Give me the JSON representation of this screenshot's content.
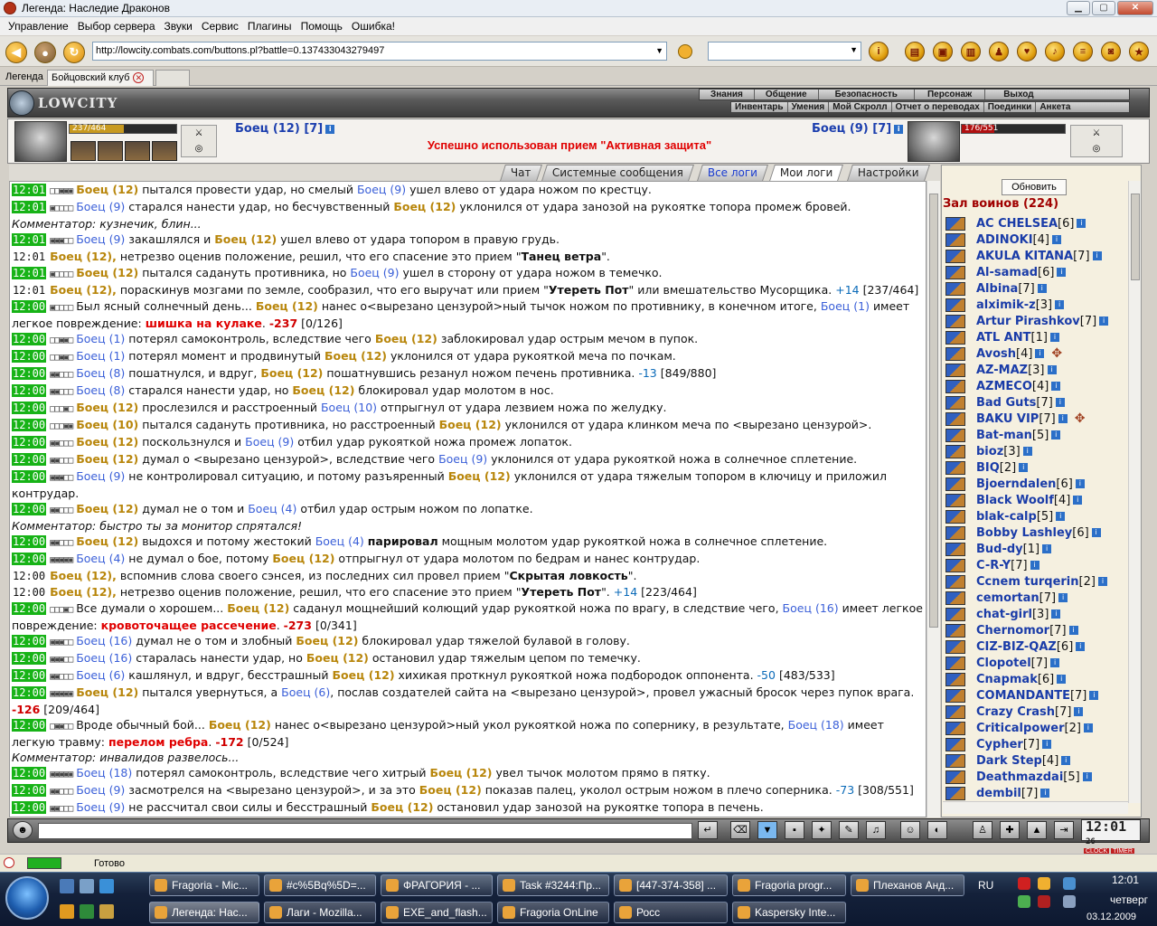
{
  "window": {
    "title": "Легенда: Наследие Драконов"
  },
  "menu": [
    "Управление",
    "Выбор сервера",
    "Звуки",
    "Сервис",
    "Плагины",
    "Помощь",
    "Ошибка!"
  ],
  "address": {
    "url": "http://lowcity.combats.com/buttons.pl?battle=0.137433043279497"
  },
  "tabs": {
    "legend": "Легенда",
    "club": "Бойцовский клуб"
  },
  "nav_top": [
    "Знания",
    "Общение",
    "Безопасность",
    "Персонаж",
    "Выход"
  ],
  "nav_bottom": [
    "Инвентарь",
    "Умения",
    "Мой Скролл",
    "Отчет о переводах",
    "Поединки",
    "Анкета"
  ],
  "logo_text": "LOWCITY",
  "player_left": {
    "name": "Боец (12) [7]",
    "hp": "237/464",
    "hp_fraction": 0.51
  },
  "player_right": {
    "name": "Боец (9) [7]",
    "hp": "176/551",
    "hp_fraction": 0.32
  },
  "status_message": "Успешно использован прием \"Активная защита\"",
  "log_tabs": [
    "Чат",
    "Системные сообщения",
    "Все логи",
    "Мои логи",
    "Настройки"
  ],
  "refresh_label": "Обновить",
  "room_title": "Зал воинов (224)",
  "users": [
    {
      "name": "AC CHELSEA",
      "level": "[6]"
    },
    {
      "name": "ADINOKI",
      "level": "[4]"
    },
    {
      "name": "AKULA KITANA",
      "level": "[7]"
    },
    {
      "name": "Al-samad",
      "level": "[6]"
    },
    {
      "name": "Albina",
      "level": "[7]"
    },
    {
      "name": "alximik-z",
      "level": "[3]"
    },
    {
      "name": "Artur Pirashkov",
      "level": "[7]"
    },
    {
      "name": "ATL ANT",
      "level": "[1]"
    },
    {
      "name": "Avosh",
      "level": "[4]"
    },
    {
      "name": "AZ-MAZ",
      "level": "[3]"
    },
    {
      "name": "AZMECO",
      "level": "[4]"
    },
    {
      "name": "Bad Guts",
      "level": "[7]"
    },
    {
      "name": "BAKU VIP",
      "level": "[7]"
    },
    {
      "name": "Bat-man",
      "level": "[5]"
    },
    {
      "name": "bioz",
      "level": "[3]"
    },
    {
      "name": "BIQ",
      "level": "[2]"
    },
    {
      "name": "Bjoerndalen",
      "level": "[6]"
    },
    {
      "name": "Black Woolf",
      "level": "[4]"
    },
    {
      "name": "blak-calp",
      "level": "[5]"
    },
    {
      "name": "Bobby Lashley",
      "level": "[6]"
    },
    {
      "name": "Bud-dy",
      "level": "[1]"
    },
    {
      "name": "C-R-Y",
      "level": "[7]"
    },
    {
      "name": "Ccnem turqerin",
      "level": "[2]"
    },
    {
      "name": "cemortan",
      "level": "[7]"
    },
    {
      "name": "chat-girl",
      "level": "[3]"
    },
    {
      "name": "Chernomor",
      "level": "[7]"
    },
    {
      "name": "CIZ-BIZ-QAZ",
      "level": "[6]"
    },
    {
      "name": "Clopotel",
      "level": "[7]"
    },
    {
      "name": "Cnapmak",
      "level": "[6]"
    },
    {
      "name": "COMANDANTE",
      "level": "[7]"
    },
    {
      "name": "Crazy Crash",
      "level": "[7]"
    },
    {
      "name": "Criticalpower",
      "level": "[2]"
    },
    {
      "name": "Cypher",
      "level": "[7]"
    },
    {
      "name": "Dark Step",
      "level": "[4]"
    },
    {
      "name": "Deathmazdai",
      "level": "[5]"
    },
    {
      "name": "dembil",
      "level": "[7]"
    }
  ],
  "clock": {
    "time": "12:01",
    "sec": "26",
    "labels": [
      "CLOCK",
      "TIMER"
    ]
  },
  "statusbar": {
    "text": "Готово"
  },
  "taskbar": {
    "top_row": [
      "Fragoria - Mic...",
      "#c%5Bq%5D=...",
      "ФРАГОРИЯ - ...",
      "Task #3244:Пр...",
      "[447-374-358] ...",
      "Fragoria progr...",
      "Плеханов Анд..."
    ],
    "bottom_row": [
      "Легенда: Нас...",
      "Лаги - Mozilla...",
      "EXE_and_flash...",
      "Fragoria OnLine",
      "Росс",
      "Kaspersky Inte..."
    ],
    "lang": "RU",
    "time": "12:01",
    "day": "четверг",
    "date": "03.12.2009"
  },
  "log": [
    {
      "t": "12:01",
      "hl": true,
      "b": "□□▣▣▣",
      "parts": [
        [
          "p",
          "Боец (12)"
        ],
        [
          "",
          "пытался провести удар, но смелый"
        ],
        [
          "e",
          "Боец (9)"
        ],
        [
          "",
          "ушел влево от удара ножом по крестцу."
        ]
      ]
    },
    {
      "t": "12:01",
      "hl": true,
      "b": "▣□□□□",
      "parts": [
        [
          "e",
          "Боец (9)"
        ],
        [
          "",
          "старался нанести удар, но бесчувственный"
        ],
        [
          "p",
          "Боец (12)"
        ],
        [
          "",
          "уклонился от удара занозой на рукоятке топора промеж бровей."
        ]
      ]
    },
    {
      "cm": "Комментатор: кузнечик, блин..."
    },
    {
      "t": "12:01",
      "hl": true,
      "b": "▣▣▣□□",
      "parts": [
        [
          "e",
          "Боец (9)"
        ],
        [
          "",
          "закашлялся и"
        ],
        [
          "p",
          "Боец (12)"
        ],
        [
          "",
          "ушел влево от удара топором в правую грудь."
        ]
      ]
    },
    {
      "t": "12:01",
      "hl": false,
      "parts": [
        [
          "p",
          "Боец (12),"
        ],
        [
          "",
          "нетрезво оценив положение, решил, что его спасение это прием \""
        ],
        [
          "bold",
          "Танец ветра"
        ],
        [
          "",
          "\"."
        ]
      ]
    },
    {
      "t": "12:01",
      "hl": true,
      "b": "▣□□□□",
      "parts": [
        [
          "p",
          "Боец (12)"
        ],
        [
          "",
          "пытался садануть противника, но"
        ],
        [
          "e",
          "Боец (9)"
        ],
        [
          "",
          "ушел в сторону от удара ножом в темечко."
        ]
      ]
    },
    {
      "t": "12:01",
      "hl": false,
      "parts": [
        [
          "p",
          "Боец (12),"
        ],
        [
          "",
          "пораскинув мозгами по земле, сообразил, что его выручат или прием \""
        ],
        [
          "bold",
          "Утереть Пот"
        ],
        [
          "",
          "\" или вмешательство Мусорщика."
        ],
        [
          "heal",
          "+14"
        ],
        [
          "",
          "[237/464]"
        ]
      ]
    },
    {
      "t": "12:00",
      "hl": true,
      "b": "▣□□□□",
      "parts": [
        [
          "",
          "Был ясный солнечный день..."
        ],
        [
          "p",
          "Боец (12)"
        ],
        [
          "",
          "нанес о<вырезано цензурой>ный тычок ножом по противнику, в конечном итоге,"
        ],
        [
          "e",
          "Боец (1)"
        ],
        [
          "",
          "имеет легкое повреждение:"
        ],
        [
          "red",
          "шишка на кулаке"
        ],
        [
          "",
          "."
        ],
        [
          "hpv",
          "-237"
        ],
        [
          "",
          "[0/126]"
        ]
      ]
    },
    {
      "t": "12:00",
      "hl": true,
      "b": "□□▣▣□",
      "parts": [
        [
          "e",
          "Боец (1)"
        ],
        [
          "",
          "потерял самоконтроль, вследствие чего"
        ],
        [
          "p",
          "Боец (12)"
        ],
        [
          "",
          "заблокировал удар острым мечом в пупок."
        ]
      ]
    },
    {
      "t": "12:00",
      "hl": true,
      "b": "□□▣▣□",
      "parts": [
        [
          "e",
          "Боец (1)"
        ],
        [
          "",
          "потерял момент и продвинутый"
        ],
        [
          "p",
          "Боец (12)"
        ],
        [
          "",
          "уклонился от удара рукояткой меча по почкам."
        ]
      ]
    },
    {
      "t": "12:00",
      "hl": true,
      "b": "▣▣□□□",
      "parts": [
        [
          "e",
          "Боец (8)"
        ],
        [
          "",
          "пошатнулся, и вдруг,"
        ],
        [
          "p",
          "Боец (12)"
        ],
        [
          "",
          "пошатнувшись резанул ножом печень противника."
        ],
        [
          "heal",
          "-13"
        ],
        [
          "",
          "[849/880]"
        ]
      ]
    },
    {
      "t": "12:00",
      "hl": true,
      "b": "▣▣□□□",
      "parts": [
        [
          "e",
          "Боец (8)"
        ],
        [
          "",
          "старался нанести удар, но"
        ],
        [
          "p",
          "Боец (12)"
        ],
        [
          "",
          "блокировал удар молотом в нос."
        ]
      ]
    },
    {
      "t": "12:00",
      "hl": true,
      "b": "□□□▣□",
      "parts": [
        [
          "p",
          "Боец (12)"
        ],
        [
          "",
          "прослезился и расстроенный"
        ],
        [
          "e",
          "Боец (10)"
        ],
        [
          "",
          "отпрыгнул от удара лезвием ножа по желудку."
        ]
      ]
    },
    {
      "t": "12:00",
      "hl": true,
      "b": "□□□▣▣",
      "parts": [
        [
          "p",
          "Боец (10)"
        ],
        [
          "",
          "пытался садануть противника, но расстроенный"
        ],
        [
          "p",
          "Боец (12)"
        ],
        [
          "",
          "уклонился от удара клинком меча по <вырезано цензурой>."
        ]
      ]
    },
    {
      "t": "12:00",
      "hl": true,
      "b": "▣▣□□□",
      "parts": [
        [
          "p",
          "Боец (12)"
        ],
        [
          "",
          "поскользнулся и"
        ],
        [
          "e",
          "Боец (9)"
        ],
        [
          "",
          "отбил удар рукояткой ножа промеж лопаток."
        ]
      ]
    },
    {
      "t": "12:00",
      "hl": true,
      "b": "▣▣□□□",
      "parts": [
        [
          "p",
          "Боец (12)"
        ],
        [
          "",
          "думал о <вырезано цензурой>, вследствие чего"
        ],
        [
          "e",
          "Боец (9)"
        ],
        [
          "",
          "уклонился от удара рукояткой ножа в солнечное сплетение."
        ]
      ]
    },
    {
      "t": "12:00",
      "hl": true,
      "b": "▣▣▣□□",
      "parts": [
        [
          "e",
          "Боец (9)"
        ],
        [
          "",
          "не контролировал ситуацию, и потому разъяренный"
        ],
        [
          "p",
          "Боец (12)"
        ],
        [
          "",
          "уклонился от удара тяжелым топором в ключицу и приложил контрудар."
        ]
      ]
    },
    {
      "t": "12:00",
      "hl": true,
      "b": "▣▣□□□",
      "parts": [
        [
          "p",
          "Боец (12)"
        ],
        [
          "",
          "думал не о том и"
        ],
        [
          "e",
          "Боец (4)"
        ],
        [
          "",
          "отбил удар острым ножом по лопатке."
        ]
      ]
    },
    {
      "cm": "Комментатор: быстро ты за монитор спрятался!"
    },
    {
      "t": "12:00",
      "hl": true,
      "b": "▣▣□□□",
      "parts": [
        [
          "p",
          "Боец (12)"
        ],
        [
          "",
          "выдохся и потому жестокий"
        ],
        [
          "e",
          "Боец (4)"
        ],
        [
          "bold",
          "парировал"
        ],
        [
          "",
          "мощным молотом удар рукояткой ножа в солнечное сплетение."
        ]
      ]
    },
    {
      "t": "12:00",
      "hl": true,
      "b": "▣▣▣▣▣",
      "parts": [
        [
          "e",
          "Боец (4)"
        ],
        [
          "",
          "не думал о бое, потому"
        ],
        [
          "p",
          "Боец (12)"
        ],
        [
          "",
          "отпрыгнул от удара молотом по бедрам и нанес контрудар."
        ]
      ]
    },
    {
      "t": "12:00",
      "hl": false,
      "parts": [
        [
          "p",
          "Боец (12),"
        ],
        [
          "",
          "вспомнив слова своего сэнсея, из последних сил провел прием \""
        ],
        [
          "bold",
          "Скрытая ловкость"
        ],
        [
          "",
          "\"."
        ]
      ]
    },
    {
      "t": "12:00",
      "hl": false,
      "parts": [
        [
          "p",
          "Боец (12),"
        ],
        [
          "",
          "нетрезво оценив положение, решил, что его спасение это прием \""
        ],
        [
          "bold",
          "Утереть Пот"
        ],
        [
          "",
          "\"."
        ],
        [
          "heal",
          "+14"
        ],
        [
          "",
          "[223/464]"
        ]
      ]
    },
    {
      "t": "12:00",
      "hl": true,
      "b": "□□□▣□",
      "parts": [
        [
          "",
          "Все думали о хорошем..."
        ],
        [
          "p",
          "Боец (12)"
        ],
        [
          "",
          "саданул мощнейший колющий удар рукояткой ножа по врагу, в следствие чего,"
        ],
        [
          "e",
          "Боец (16)"
        ],
        [
          "",
          "имеет легкое повреждение:"
        ],
        [
          "red",
          "кровоточащее рассечение"
        ],
        [
          "",
          "."
        ],
        [
          "hpv",
          "-273"
        ],
        [
          "",
          "[0/341]"
        ]
      ]
    },
    {
      "t": "12:00",
      "hl": true,
      "b": "▣▣▣□□",
      "parts": [
        [
          "e",
          "Боец (16)"
        ],
        [
          "",
          "думал не о том и злобный"
        ],
        [
          "p",
          "Боец (12)"
        ],
        [
          "",
          "блокировал удар тяжелой булавой в голову."
        ]
      ]
    },
    {
      "t": "12:00",
      "hl": true,
      "b": "▣▣▣□□",
      "parts": [
        [
          "e",
          "Боец (16)"
        ],
        [
          "",
          "старалась нанести удар, но"
        ],
        [
          "p",
          "Боец (12)"
        ],
        [
          "",
          "остановил удар тяжелым цепом по темечку."
        ]
      ]
    },
    {
      "t": "12:00",
      "hl": true,
      "b": "▣▣□□□",
      "parts": [
        [
          "e",
          "Боец (6)"
        ],
        [
          "",
          "кашлянул, и вдруг, бесстрашный"
        ],
        [
          "p",
          "Боец (12)"
        ],
        [
          "",
          "хихикая проткнул рукояткой ножа подбородок оппонента."
        ],
        [
          "heal",
          "-50"
        ],
        [
          "",
          "[483/533]"
        ]
      ]
    },
    {
      "t": "12:00",
      "hl": true,
      "b": "▣▣▣▣▣",
      "parts": [
        [
          "p",
          "Боец (12)"
        ],
        [
          "",
          "пытался увернуться, а"
        ],
        [
          "e",
          "Боец (6)"
        ],
        [
          "",
          ", послав создателей сайта на <вырезано цензурой>, провел ужасный бросок через пупок врага."
        ],
        [
          "hpv",
          "-126"
        ],
        [
          "",
          "[209/464]"
        ]
      ]
    },
    {
      "t": "12:00",
      "hl": true,
      "b": "□▣▣□□",
      "parts": [
        [
          "",
          "Вроде обычный бой..."
        ],
        [
          "p",
          "Боец (12)"
        ],
        [
          "",
          "нанес о<вырезано цензурой>ный укол рукояткой ножа по сопернику, в результате,"
        ],
        [
          "e",
          "Боец (18)"
        ],
        [
          "",
          "имеет легкую травму:"
        ],
        [
          "red",
          "перелом ребра"
        ],
        [
          "",
          "."
        ],
        [
          "hpv",
          "-172"
        ],
        [
          "",
          "[0/524]"
        ]
      ]
    },
    {
      "cm": "Комментатор: инвалидов развелось..."
    },
    {
      "t": "12:00",
      "hl": true,
      "b": "▣▣▣▣▣",
      "parts": [
        [
          "e",
          "Боец (18)"
        ],
        [
          "",
          "потерял самоконтроль, вследствие чего хитрый"
        ],
        [
          "p",
          "Боец (12)"
        ],
        [
          "",
          "увел тычок молотом прямо в пятку."
        ]
      ]
    },
    {
      "t": "12:00",
      "hl": true,
      "b": "▣▣□□□",
      "parts": [
        [
          "e",
          "Боец (9)"
        ],
        [
          "",
          "засмотрелся на <вырезано цензурой>, и за это"
        ],
        [
          "p",
          "Боец (12)"
        ],
        [
          "",
          "показав палец, уколол острым ножом в плечо соперника."
        ],
        [
          "heal",
          "-73"
        ],
        [
          "",
          "[308/551]"
        ]
      ]
    },
    {
      "t": "12:00",
      "hl": true,
      "b": "▣▣□□□",
      "parts": [
        [
          "e",
          "Боец (9)"
        ],
        [
          "",
          "не рассчитал свои силы и бесстрашный"
        ],
        [
          "p",
          "Боец (12)"
        ],
        [
          "",
          "остановил удар занозой на рукоятке топора в печень."
        ]
      ]
    }
  ]
}
